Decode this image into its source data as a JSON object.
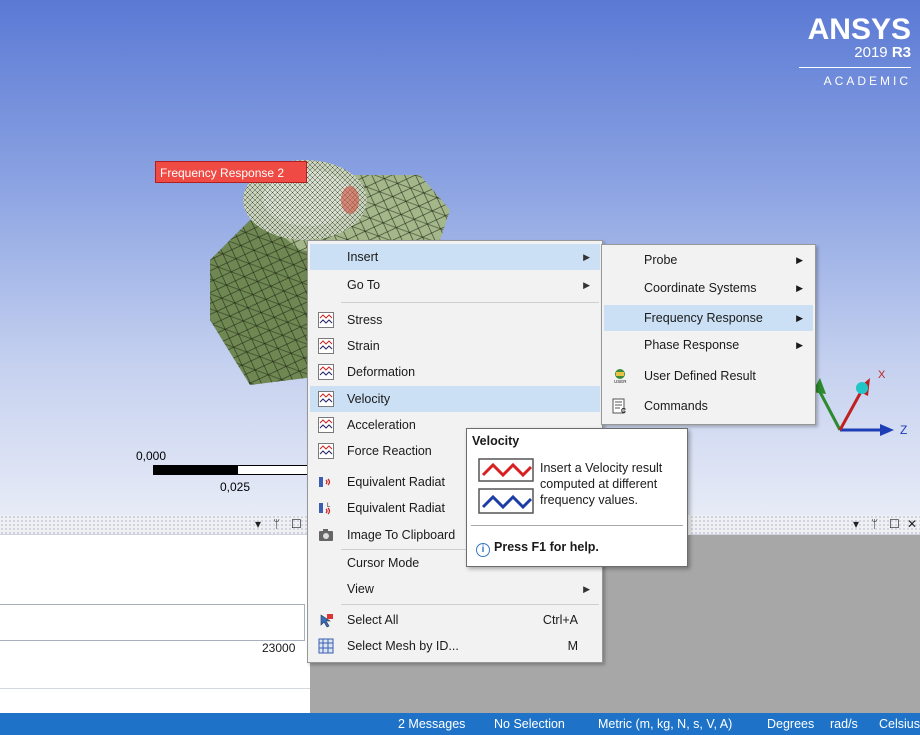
{
  "brand": {
    "name": "ANSYS",
    "version_year": "2019",
    "version_release": "R3",
    "edition": "ACADEMIC"
  },
  "viewport": {
    "result_label": "Frequency Response 2",
    "scale": {
      "left_value": "0,000",
      "mid_value": "0,025"
    },
    "triad": {
      "z_label": "Z"
    }
  },
  "panes": {
    "left_toolbar": {
      "dropdown_icon": "dropdown-arrow-icon",
      "pin_icon": "pin-icon",
      "maximize_icon": "maximize-icon"
    },
    "right_toolbar": {
      "dropdown_icon": "dropdown-arrow-icon",
      "pin_icon": "pin-icon",
      "maximize_icon": "maximize-icon",
      "close_icon": "close-icon"
    },
    "value": "23000"
  },
  "context_menu": {
    "insert": "Insert",
    "go_to": "Go To",
    "items": [
      {
        "label": "Stress",
        "icon": "result-icon"
      },
      {
        "label": "Strain",
        "icon": "result-icon"
      },
      {
        "label": "Deformation",
        "icon": "result-icon"
      },
      {
        "label": "Velocity",
        "icon": "result-icon"
      },
      {
        "label": "Acceleration",
        "icon": "result-icon"
      },
      {
        "label": "Force Reaction",
        "icon": "result-icon"
      },
      {
        "label": "Equivalent Radiat",
        "icon": "radiated-power-icon"
      },
      {
        "label": "Equivalent Radiat",
        "icon": "radiated-power-level-icon"
      }
    ],
    "image_to_clipboard": "Image To Clipboard",
    "cursor_mode": "Cursor Mode",
    "view": "View",
    "select_all": "Select All",
    "select_all_shortcut": "Ctrl+A",
    "select_mesh": "Select Mesh by ID...",
    "select_mesh_shortcut": "M"
  },
  "submenu": {
    "items": [
      {
        "label": "Probe",
        "has_submenu": true
      },
      {
        "label": "Coordinate Systems",
        "has_submenu": true
      },
      {
        "label": "Frequency Response",
        "has_submenu": true
      },
      {
        "label": "Phase Response",
        "has_submenu": true
      },
      {
        "label": "User Defined Result",
        "has_submenu": false
      },
      {
        "label": "Commands",
        "has_submenu": false
      }
    ]
  },
  "tooltip": {
    "title": "Velocity",
    "body": "Insert a Velocity result computed at different frequency values.",
    "help": "Press F1 for help."
  },
  "status_bar": {
    "messages": "2 Messages",
    "selection": "No Selection",
    "unit_system": "Metric (m, kg, N, s, V, A)",
    "angle": "Degrees",
    "angular_velocity": "rad/s",
    "temperature": "Celsius"
  },
  "colors": {
    "accent": "#1e73c8",
    "menu_highlight": "#cce0f5",
    "result_label": "#f04a44"
  }
}
